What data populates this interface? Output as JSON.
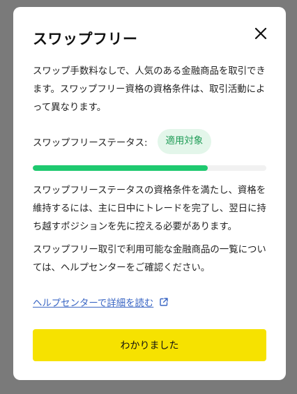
{
  "modal": {
    "title": "スワップフリー",
    "intro": "スワップ手数料なしで、人気のある金融商品を取引できます。スワップフリー資格の資格条件は、取引活動によって異なります。",
    "status": {
      "label": "スワップフリーステータス:",
      "badge": "適用対象",
      "badge_color": "#1d9b55",
      "progress_fraction": 0.75,
      "progress_color": "#1ec96f"
    },
    "conditions": "スワップフリーステータスの資格条件を満たし、資格を維持するには、主に日中にトレードを完了し、翌日に持ち越すポジションを先に控える必要があります。",
    "products_note": "スワップフリー取引で利用可能な金融商品の一覧については、ヘルプセンターをご確認ください。",
    "help_link": "ヘルプセンターで詳細を読む",
    "confirm_button": "わかりました",
    "accent_color": "#f6e200",
    "icons": {
      "close": "close-icon",
      "external": "external-link-icon"
    }
  }
}
